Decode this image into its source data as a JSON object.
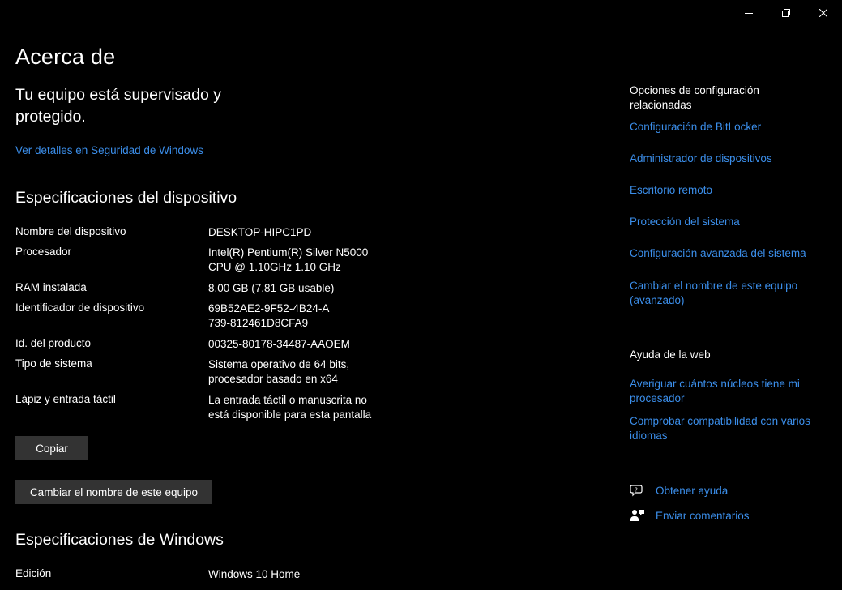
{
  "window": {
    "minimize_glyph": "—",
    "colors": {
      "background": "#000000",
      "link": "#3b8eea",
      "button": "#333333"
    }
  },
  "page": {
    "title": "Acerca de"
  },
  "security": {
    "title": "Tu equipo está supervisado y protegido.",
    "link": "Ver detalles en Seguridad de Windows"
  },
  "device_specs": {
    "title": "Especificaciones del dispositivo",
    "rows": [
      {
        "label": "Nombre del dispositivo",
        "value": "DESKTOP-HIPC1PD"
      },
      {
        "label": "Procesador",
        "value": "Intel(R) Pentium(R) Silver N5000 CPU @ 1.10GHz   1.10 GHz"
      },
      {
        "label": "RAM instalada",
        "value": "8.00 GB (7.81 GB usable)"
      },
      {
        "label": "Identificador de dispositivo",
        "value": "69B52AE2-9F52-4B24-A739-812461D8CFA9"
      },
      {
        "label": "Id. del producto",
        "value": "00325-80178-34487-AAOEM"
      },
      {
        "label": "Tipo de sistema",
        "value": "Sistema operativo de 64 bits, procesador basado en x64"
      },
      {
        "label": "Lápiz y entrada táctil",
        "value": "La entrada táctil o manuscrita no está disponible para esta pantalla"
      }
    ],
    "copy_button": "Copiar",
    "rename_button": "Cambiar el nombre de este equipo"
  },
  "windows_specs": {
    "title": "Especificaciones de Windows",
    "rows": [
      {
        "label": "Edición",
        "value": "Windows 10 Home"
      }
    ]
  },
  "related": {
    "heading": "Opciones de configuración relacionadas",
    "links": [
      "Configuración de BitLocker",
      "Administrador de dispositivos",
      "Escritorio remoto",
      "Protección del sistema",
      "Configuración avanzada del sistema",
      "Cambiar el nombre de este equipo (avanzado)"
    ]
  },
  "web_help": {
    "heading": "Ayuda de la web",
    "links": [
      "Averiguar cuántos núcleos tiene mi procesador",
      "Comprobar compatibilidad con varios idiomas"
    ]
  },
  "support": {
    "get_help": {
      "label": "Obtener ayuda",
      "icon": "chat-help-icon"
    },
    "feedback": {
      "label": "Enviar comentarios",
      "icon": "feedback-icon"
    }
  }
}
